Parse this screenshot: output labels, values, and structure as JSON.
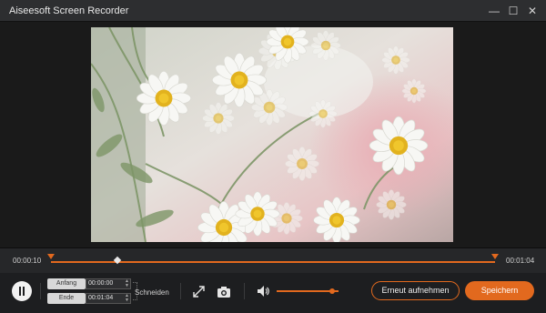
{
  "window": {
    "title": "Aiseesoft Screen Recorder",
    "minimize_glyph": "—",
    "maximize_glyph": "☐",
    "close_glyph": "✕"
  },
  "timeline": {
    "start_time": "00:00:10",
    "end_time": "00:01:04",
    "playhead_fraction": 0.15
  },
  "trim": {
    "start_label": "Anfang",
    "start_value": "00:00:00",
    "end_label": "Ende",
    "end_value": "00:01:04",
    "cut_label": "Schneiden"
  },
  "volume": {
    "level_fraction": 0.9
  },
  "buttons": {
    "rerecord": "Erneut aufnehmen",
    "save": "Speichern"
  },
  "icons": [
    "pause-icon",
    "expand-icon",
    "camera-icon",
    "volume-icon"
  ],
  "colors": {
    "accent": "#e2691e"
  }
}
